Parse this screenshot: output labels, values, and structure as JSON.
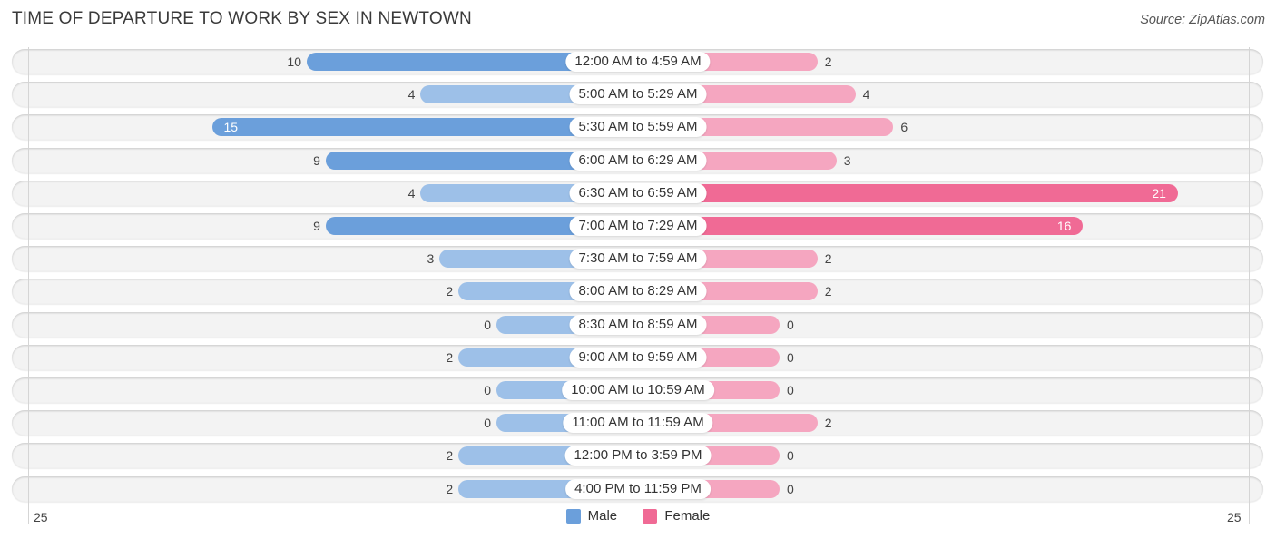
{
  "chart_data": {
    "type": "bar",
    "orientation": "horizontal-diverging",
    "title": "TIME OF DEPARTURE TO WORK BY SEX IN NEWTOWN",
    "source": "Source: ZipAtlas.com",
    "categories": [
      "12:00 AM to 4:59 AM",
      "5:00 AM to 5:29 AM",
      "5:30 AM to 5:59 AM",
      "6:00 AM to 6:29 AM",
      "6:30 AM to 6:59 AM",
      "7:00 AM to 7:29 AM",
      "7:30 AM to 7:59 AM",
      "8:00 AM to 8:29 AM",
      "8:30 AM to 8:59 AM",
      "9:00 AM to 9:59 AM",
      "10:00 AM to 10:59 AM",
      "11:00 AM to 11:59 AM",
      "12:00 PM to 3:59 PM",
      "4:00 PM to 11:59 PM"
    ],
    "series": [
      {
        "name": "Male",
        "color": "#6b9fdb",
        "light_color": "#9dc0e8",
        "values": [
          10,
          4,
          15,
          9,
          4,
          9,
          3,
          2,
          0,
          2,
          0,
          0,
          2,
          2
        ]
      },
      {
        "name": "Female",
        "color": "#f06a95",
        "light_color": "#f5a6c0",
        "values": [
          2,
          4,
          6,
          3,
          21,
          16,
          2,
          2,
          0,
          0,
          0,
          2,
          0,
          0
        ]
      }
    ],
    "axis": {
      "left_tick": "25",
      "right_tick": "25",
      "max": 25
    },
    "legend": {
      "position": "bottom-center",
      "entries": [
        "Male",
        "Female"
      ]
    },
    "grid": false
  }
}
